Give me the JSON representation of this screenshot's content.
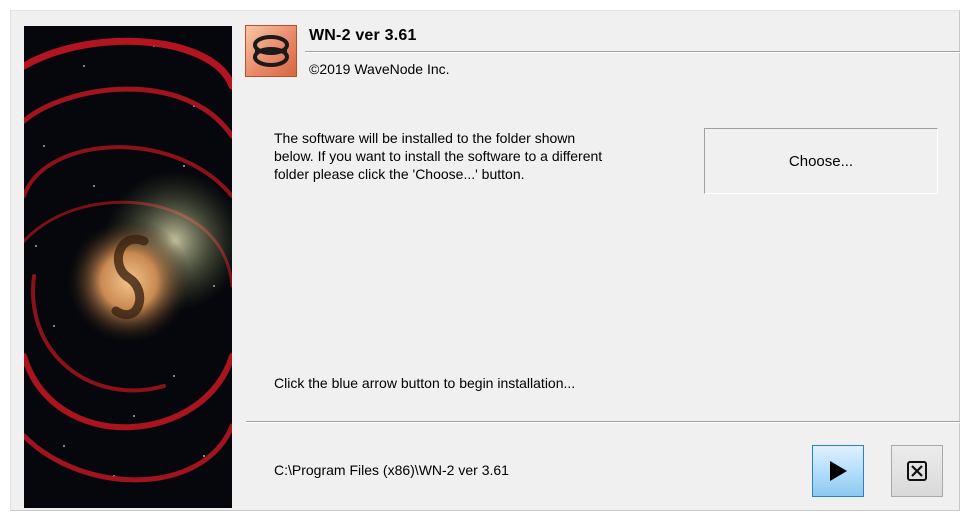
{
  "window": {
    "app_title": "WN-2 ver 3.61",
    "copyright": "©2019 WaveNode Inc."
  },
  "main": {
    "description": "The software will be installed to the folder shown\nbelow.  If you want to install the software to a different\nfolder please click the 'Choose...' button.",
    "choose_label": "Choose...",
    "begin_hint": "Click the blue arrow button to begin installation...",
    "install_path": "C:\\Program Files (x86)\\WN-2 ver 3.61"
  },
  "footer": {
    "start_icon": "play-icon",
    "cancel_icon": "close-icon"
  },
  "colors": {
    "start_button": "#b9e0fb",
    "logo_background": "#e9896a",
    "window_background": "#f0f0f0"
  }
}
